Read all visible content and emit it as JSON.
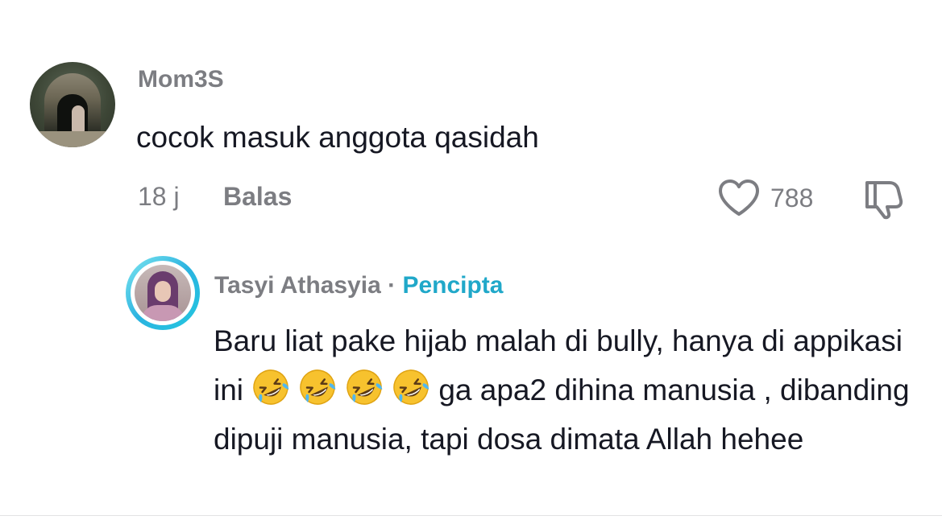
{
  "comments": [
    {
      "username": "Mom3S",
      "text": "cocok masuk anggota qasidah",
      "time": "18 j",
      "reply_label": "Balas",
      "likes": "788"
    }
  ],
  "reply": {
    "username": "Tasyi Athasyia",
    "separator": " · ",
    "badge": "Pencipta",
    "text_part1": "Baru liat pake hijab malah di bully, hanya di appikasi ini ",
    "emoji_count": 4,
    "emoji_name": "rolling-on-the-floor-laughing-emoji",
    "text_part2": "ga apa2 dihina manusia , dibanding dipuji manusia, tapi dosa dimata Allah hehee"
  },
  "colors": {
    "text_primary": "#161823",
    "text_secondary": "#7c7d82",
    "creator_badge": "#20a8c9",
    "story_ring": "#2bb3e0"
  },
  "icons": {
    "like": "heart-outline-icon",
    "dislike": "thumbs-down-icon"
  }
}
